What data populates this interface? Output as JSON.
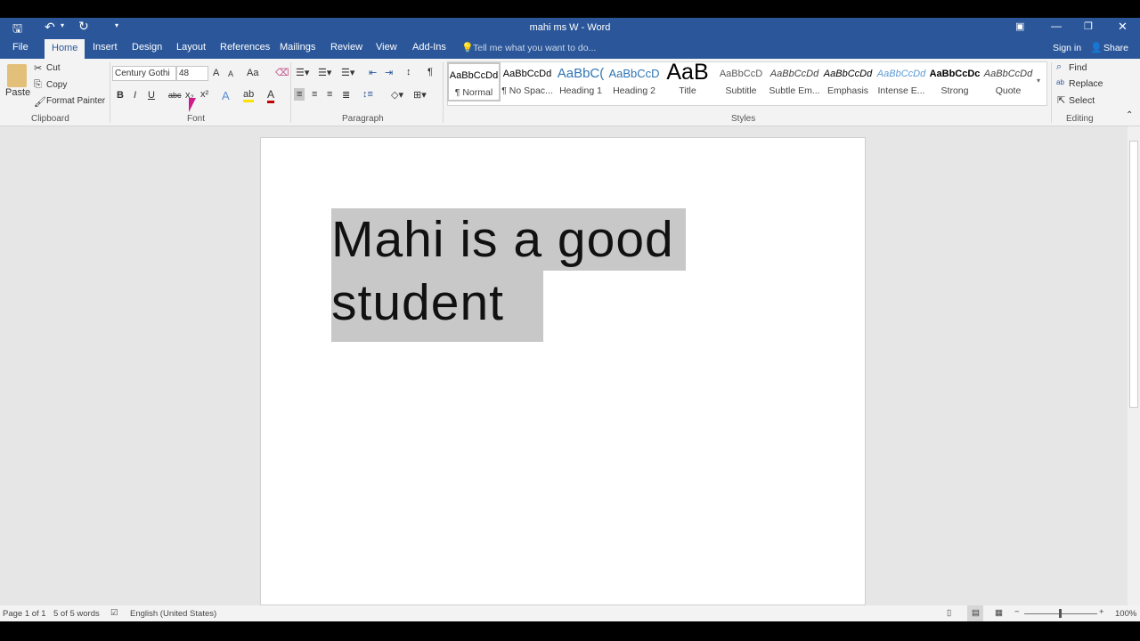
{
  "window": {
    "title": "mahi ms W - Word"
  },
  "qat": {
    "save_icon": "save-icon",
    "undo_icon": "undo-icon",
    "redo_icon": "redo-icon"
  },
  "tabs": [
    {
      "label": "File"
    },
    {
      "label": "Home"
    },
    {
      "label": "Insert"
    },
    {
      "label": "Design"
    },
    {
      "label": "Layout"
    },
    {
      "label": "References"
    },
    {
      "label": "Mailings"
    },
    {
      "label": "Review"
    },
    {
      "label": "View"
    },
    {
      "label": "Add-Ins"
    }
  ],
  "tell_me": "Tell me what you want to do...",
  "sign_in": "Sign in",
  "share": "Share",
  "clipboard": {
    "paste": "Paste",
    "cut": "Cut",
    "copy": "Copy",
    "format_painter": "Format Painter",
    "label": "Clipboard"
  },
  "font": {
    "name": "Century Gothi",
    "size": "48",
    "label": "Font",
    "bold": "B",
    "italic": "I",
    "underline": "U",
    "strike": "abc",
    "grow": "A",
    "shrink": "A",
    "case": "Aa"
  },
  "paragraph": {
    "label": "Paragraph"
  },
  "styles": {
    "label": "Styles",
    "items": [
      {
        "preview": "AaBbCcDd",
        "name": "¶ Normal"
      },
      {
        "preview": "AaBbCcDd",
        "name": "¶ No Spac..."
      },
      {
        "preview": "AaBbC(",
        "name": "Heading 1"
      },
      {
        "preview": "AaBbCcD",
        "name": "Heading 2"
      },
      {
        "preview": "AaB",
        "name": "Title"
      },
      {
        "preview": "AaBbCcD",
        "name": "Subtitle"
      },
      {
        "preview": "AaBbCcDd",
        "name": "Subtle Em..."
      },
      {
        "preview": "AaBbCcDd",
        "name": "Emphasis"
      },
      {
        "preview": "AaBbCcDd",
        "name": "Intense E..."
      },
      {
        "preview": "AaBbCcDc",
        "name": "Strong"
      },
      {
        "preview": "AaBbCcDd",
        "name": "Quote"
      }
    ]
  },
  "editing": {
    "find": "Find",
    "replace": "Replace",
    "select": "Select",
    "label": "Editing"
  },
  "document": {
    "line1": "Mahi is a good",
    "line2": "student"
  },
  "status": {
    "page": "Page 1 of 1",
    "words": "5 of 5 words",
    "language": "English (United States)",
    "zoom": "100%"
  },
  "colors": {
    "accent": "#2b579a",
    "selection": "#c8c8c8"
  }
}
